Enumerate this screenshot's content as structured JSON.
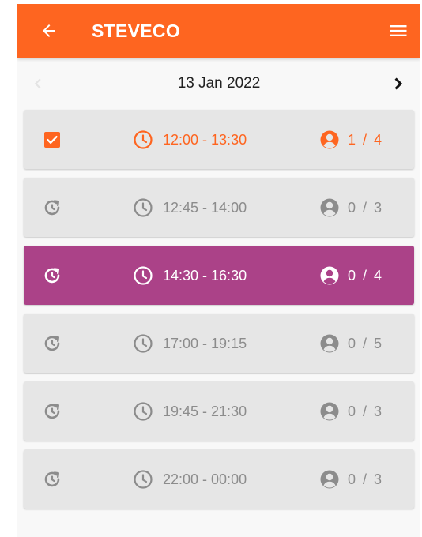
{
  "appbar": {
    "title": "STEVECO",
    "back_icon": "arrow-left-icon",
    "menu_icon": "hamburger-menu-icon",
    "color": "#fe6520"
  },
  "date_nav": {
    "date": "13 Jan 2022",
    "prev_enabled": false,
    "next_enabled": true
  },
  "colors": {
    "accent": "#fe6520",
    "selected": "#ab4288",
    "muted": "#8c8c8c",
    "card": "#e6e6e6"
  },
  "slots": [
    {
      "time": "12:00 - 13:30",
      "capacity": "1 / 4",
      "state": "booked",
      "status_icon": "checkbox-checked-icon"
    },
    {
      "time": "12:45 - 14:00",
      "capacity": "0 / 3",
      "state": "available",
      "status_icon": "schedule-refresh-icon"
    },
    {
      "time": "14:30 - 16:30",
      "capacity": "0 / 4",
      "state": "selected",
      "status_icon": "schedule-refresh-icon"
    },
    {
      "time": "17:00 - 19:15",
      "capacity": "0 / 5",
      "state": "available",
      "status_icon": "schedule-refresh-icon"
    },
    {
      "time": "19:45 - 21:30",
      "capacity": "0 / 3",
      "state": "available",
      "status_icon": "schedule-refresh-icon"
    },
    {
      "time": "22:00 - 00:00",
      "capacity": "0 / 3",
      "state": "available",
      "status_icon": "schedule-refresh-icon"
    }
  ]
}
